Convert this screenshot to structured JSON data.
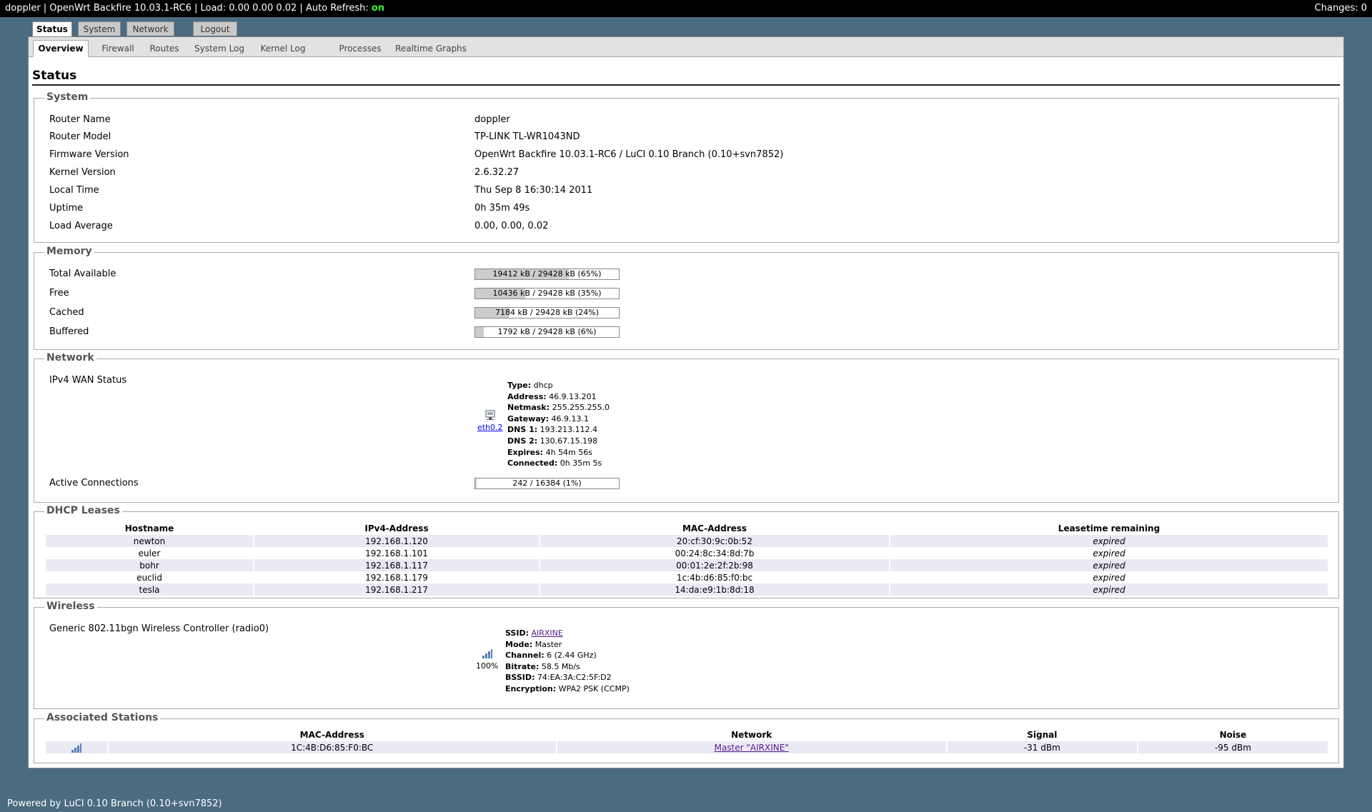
{
  "topbar": {
    "text": "doppler | OpenWrt Backfire 10.03.1-RC6 | Load: 0.00 0.00 0.02 | Auto Refresh: ",
    "autorefresh": "on",
    "changes": "Changes: 0"
  },
  "main_tabs": [
    "Status",
    "System",
    "Network",
    "Logout"
  ],
  "sub_tabs": [
    "Overview",
    "Firewall",
    "Routes",
    "System Log",
    "Kernel Log",
    "Processes",
    "Realtime Graphs"
  ],
  "page_title": "Status",
  "system": {
    "legend": "System",
    "rows": [
      {
        "label": "Router Name",
        "value": "doppler"
      },
      {
        "label": "Router Model",
        "value": "TP-LINK TL-WR1043ND"
      },
      {
        "label": "Firmware Version",
        "value": "OpenWrt Backfire 10.03.1-RC6 / LuCI 0.10 Branch (0.10+svn7852)"
      },
      {
        "label": "Kernel Version",
        "value": "2.6.32.27"
      },
      {
        "label": "Local Time",
        "value": "Thu Sep 8 16:30:14 2011"
      },
      {
        "label": "Uptime",
        "value": "0h 35m 49s"
      },
      {
        "label": "Load Average",
        "value": "0.00, 0.00, 0.02"
      }
    ]
  },
  "memory": {
    "legend": "Memory",
    "rows": [
      {
        "label": "Total Available",
        "text": "19412 kB / 29428 kB (65%)",
        "fraction": 0.65
      },
      {
        "label": "Free",
        "text": "10436 kB / 29428 kB (35%)",
        "fraction": 0.35
      },
      {
        "label": "Cached",
        "text": "7184 kB / 29428 kB (24%)",
        "fraction": 0.24
      },
      {
        "label": "Buffered",
        "text": "1792 kB / 29428 kB (6%)",
        "fraction": 0.06
      }
    ]
  },
  "network": {
    "legend": "Network",
    "wan_label": "IPv4 WAN Status",
    "iface": "eth0.2",
    "wan": [
      {
        "k": "Type:",
        "v": "dhcp"
      },
      {
        "k": "Address:",
        "v": "46.9.13.201"
      },
      {
        "k": "Netmask:",
        "v": "255.255.255.0"
      },
      {
        "k": "Gateway:",
        "v": "46.9.13.1"
      },
      {
        "k": "DNS 1:",
        "v": "193.213.112.4"
      },
      {
        "k": "DNS 2:",
        "v": "130.67.15.198"
      },
      {
        "k": "Expires:",
        "v": "4h 54m 56s"
      },
      {
        "k": "Connected:",
        "v": "0h 35m 5s"
      }
    ],
    "conn_label": "Active Connections",
    "conn_text": "242 / 16384 (1%)",
    "conn_fraction": 0.01
  },
  "dhcp": {
    "legend": "DHCP Leases",
    "headers": [
      "Hostname",
      "IPv4-Address",
      "MAC-Address",
      "Leasetime remaining"
    ],
    "rows": [
      [
        "newton",
        "192.168.1.120",
        "20:cf:30:9c:0b:52",
        "expired"
      ],
      [
        "euler",
        "192.168.1.101",
        "00:24:8c:34:8d:7b",
        "expired"
      ],
      [
        "bohr",
        "192.168.1.117",
        "00:01:2e:2f:2b:98",
        "expired"
      ],
      [
        "euclid",
        "192.168.1.179",
        "1c:4b:d6:85:f0:bc",
        "expired"
      ],
      [
        "tesla",
        "192.168.1.217",
        "14:da:e9:1b:8d:18",
        "expired"
      ]
    ]
  },
  "wireless": {
    "legend": "Wireless",
    "device": "Generic 802.11bgn Wireless Controller (radio0)",
    "quality": "100%",
    "info": [
      {
        "k": "SSID:",
        "v": "AIRXINE",
        "link": true
      },
      {
        "k": "Mode:",
        "v": "Master"
      },
      {
        "k": "Channel:",
        "v": "6 (2.44 GHz)"
      },
      {
        "k": "Bitrate:",
        "v": "58.5 Mb/s"
      },
      {
        "k": "BSSID:",
        "v": "74:EA:3A:C2:5F:D2"
      },
      {
        "k": "Encryption:",
        "v": "WPA2 PSK (CCMP)"
      }
    ]
  },
  "stations": {
    "legend": "Associated Stations",
    "headers": [
      "",
      "MAC-Address",
      "Network",
      "Signal",
      "Noise"
    ],
    "rows": [
      {
        "mac": "1C:4B:D6:85:F0:BC",
        "network": "Master \"AIRXINE\"",
        "signal": "-31 dBm",
        "noise": "-95 dBm"
      }
    ]
  },
  "footer": "Powered by LuCI 0.10 Branch (0.10+svn7852)",
  "colors": {
    "background": "#4a6b80",
    "autorefresh_on": "#33ff33",
    "row_alt": "#eaeaf5"
  }
}
